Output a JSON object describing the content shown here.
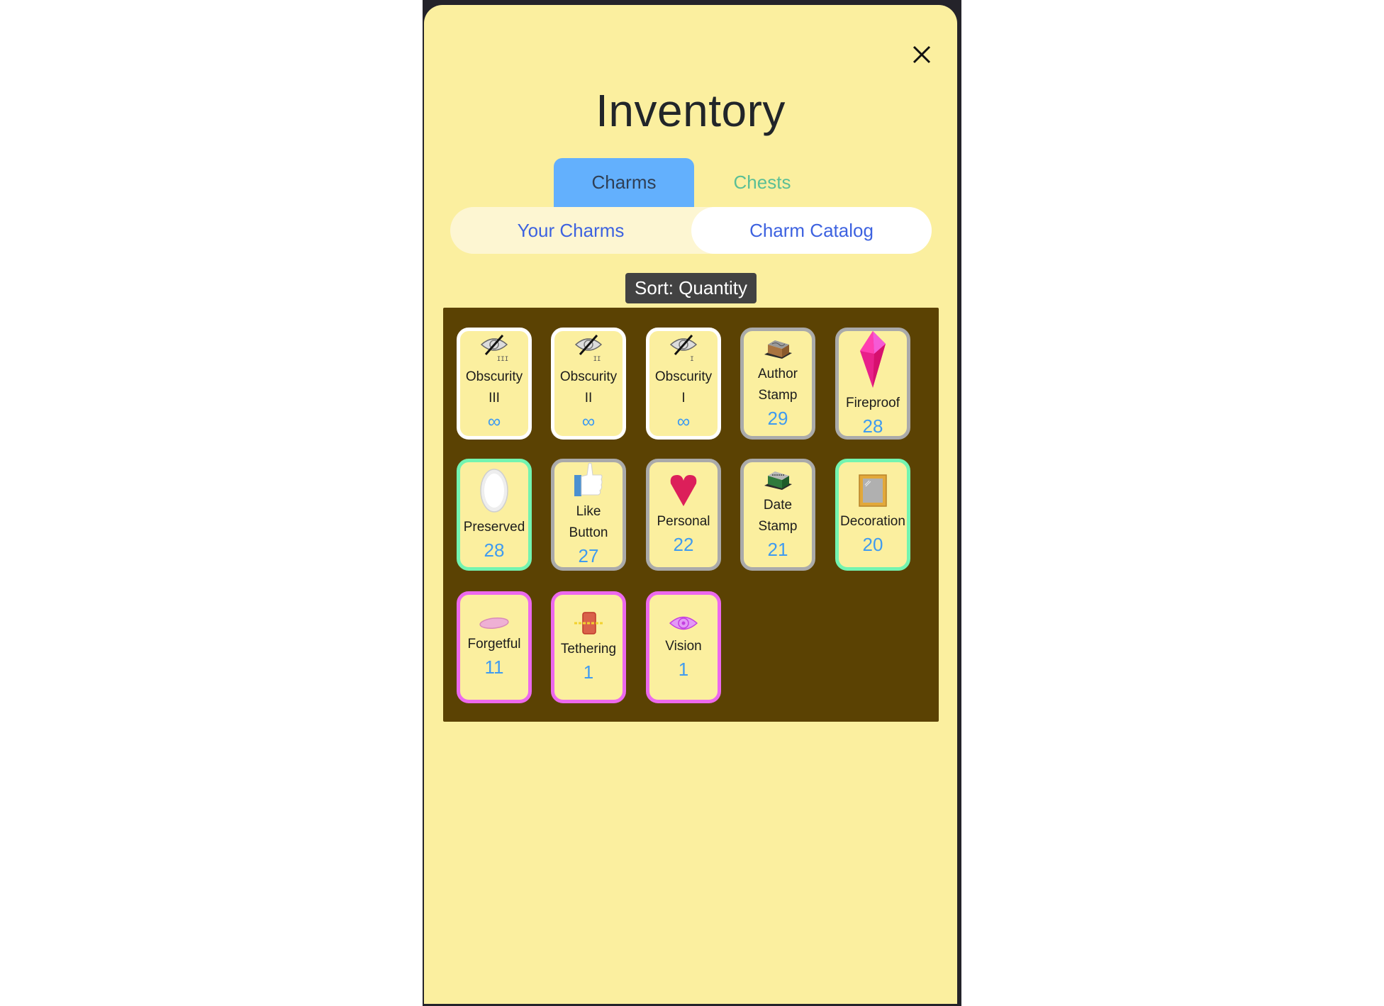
{
  "dialog": {
    "title": "Inventory",
    "close_icon": "close-icon"
  },
  "tabs": [
    {
      "label": "Charms",
      "active": true
    },
    {
      "label": "Chests",
      "active": false
    }
  ],
  "subtabs": [
    {
      "label": "Your Charms",
      "active": false
    },
    {
      "label": "Charm Catalog",
      "active": true
    }
  ],
  "sort": {
    "label": "Sort: Quantity"
  },
  "colors": {
    "panel": "#fbef9f",
    "grid_background": "#5b4203",
    "active_tab": "#63b0fd",
    "quantity_text": "#3f9bf0",
    "border_common": "#ffffff",
    "border_uncommon": "#aaaaaa",
    "border_rare": "#73f4b0",
    "border_epic": "#ec68ee"
  },
  "charms": [
    {
      "name": "Obscurity III",
      "name_lines": [
        "Obscurity",
        "III"
      ],
      "quantity": "∞",
      "icon": "obscurity-eye-icon",
      "level": "III",
      "border": "white"
    },
    {
      "name": "Obscurity II",
      "name_lines": [
        "Obscurity",
        "II"
      ],
      "quantity": "∞",
      "icon": "obscurity-eye-icon",
      "level": "II",
      "border": "white"
    },
    {
      "name": "Obscurity I",
      "name_lines": [
        "Obscurity",
        "I"
      ],
      "quantity": "∞",
      "icon": "obscurity-eye-icon",
      "level": "I",
      "border": "white"
    },
    {
      "name": "Author Stamp",
      "name_lines": [
        "Author",
        "Stamp"
      ],
      "quantity": "29",
      "icon": "author-stamp-icon",
      "border": "gray"
    },
    {
      "name": "Fireproof",
      "name_lines": [
        "Fireproof"
      ],
      "quantity": "28",
      "icon": "crystal-icon",
      "border": "gray"
    },
    {
      "name": "Preserved",
      "name_lines": [
        "Preserved"
      ],
      "quantity": "28",
      "icon": "egg-icon",
      "border": "green"
    },
    {
      "name": "Like Button",
      "name_lines": [
        "Like",
        "Button"
      ],
      "quantity": "27",
      "icon": "thumbs-up-icon",
      "border": "gray"
    },
    {
      "name": "Personal",
      "name_lines": [
        "Personal"
      ],
      "quantity": "22",
      "icon": "heart-icon",
      "border": "gray"
    },
    {
      "name": "Date Stamp",
      "name_lines": [
        "Date",
        "Stamp"
      ],
      "quantity": "21",
      "icon": "date-stamp-icon",
      "border": "gray"
    },
    {
      "name": "Decoration",
      "name_lines": [
        "Decoration"
      ],
      "quantity": "20",
      "icon": "mirror-frame-icon",
      "border": "green"
    },
    {
      "name": "Forgetful",
      "name_lines": [
        "Forgetful"
      ],
      "quantity": "11",
      "icon": "pink-disc-icon",
      "border": "pink"
    },
    {
      "name": "Tethering",
      "name_lines": [
        "Tethering"
      ],
      "quantity": "1",
      "icon": "chained-tag-icon",
      "border": "pink"
    },
    {
      "name": "Vision",
      "name_lines": [
        "Vision"
      ],
      "quantity": "1",
      "icon": "vision-eye-icon",
      "border": "pink"
    }
  ]
}
